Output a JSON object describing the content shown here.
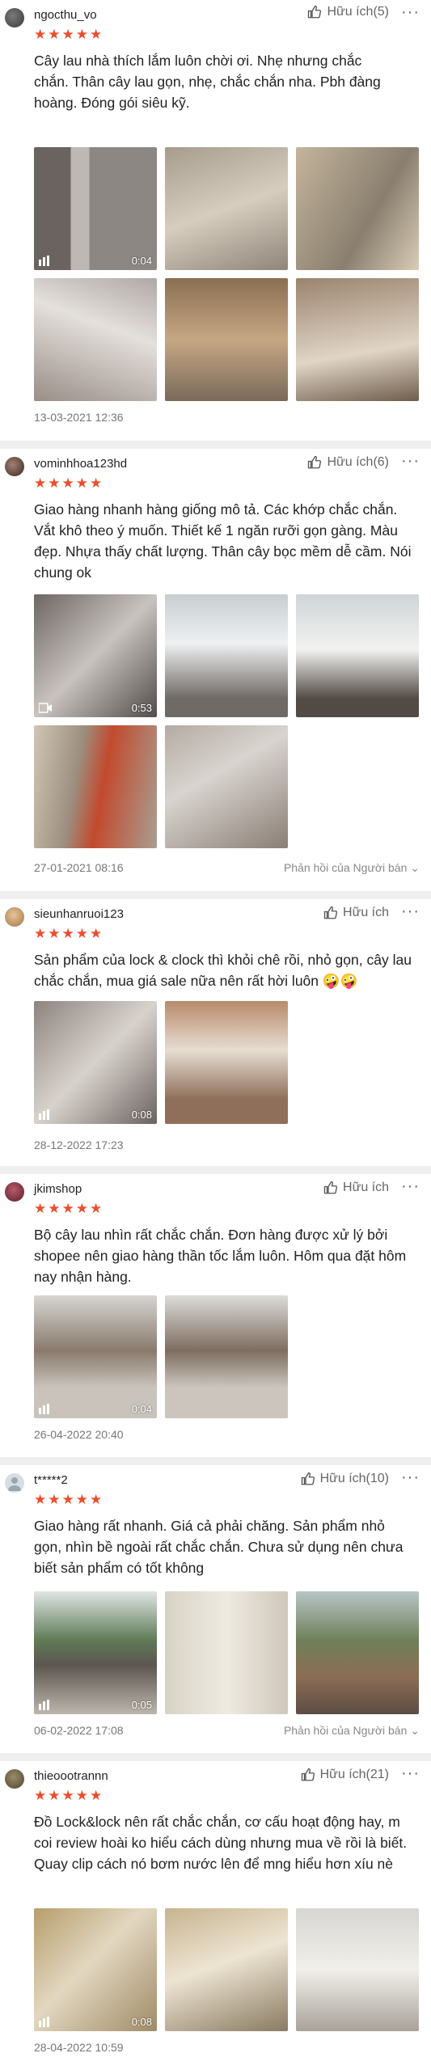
{
  "reviews": [
    {
      "username": "ngocthu_vo",
      "helpful": "Hữu ích(5)",
      "text": "Cây lau nhà thích lắm luôn chời ơi. Nhẹ nhưng chắc chắn. Thân cây lau gọn, nhẹ, chắc chắn nha. Pbh đàng hoàng. Đóng gói siêu kỹ.",
      "media_durations": [
        "0:04"
      ],
      "date": "13-03-2021 12:36",
      "reply": ""
    },
    {
      "username": "vominhhoa123hd",
      "helpful": "Hữu ích(6)",
      "text": "Giao hàng nhanh hàng giống mô tả. Các khớp chắc chắn. Vắt khô theo ý muốn. Thiết kế 1 ngăn rưỡi gọn gàng. Màu đẹp. Nhựa thấy chất lượng. Thân cây bọc mềm dễ cầm. Nói chung ok",
      "media_durations": [
        "0:53"
      ],
      "date": "27-01-2021 08:16",
      "reply": "Phản hồi của Người bán"
    },
    {
      "username": "sieunhanruoi123",
      "helpful": "Hữu ích",
      "text": "Sản phẩm của lock & clock thì khỏi chê rồi, nhỏ gọn, cây lau chắc chắn, mua giá sale nữa nên rất hời luôn 🤪🤪",
      "media_durations": [
        "0:08"
      ],
      "date": "28-12-2022 17:23",
      "reply": ""
    },
    {
      "username": "jkimshop",
      "helpful": "Hữu ích",
      "text": "Bộ cây lau nhìn rất chắc chắn. Đơn hàng được xử lý bởi shopee nên giao hàng thần tốc lắm luôn. Hôm qua đặt hôm nay nhận hàng.",
      "media_durations": [
        "0:04"
      ],
      "date": "26-04-2022 20:40",
      "reply": ""
    },
    {
      "username": "t*****2",
      "helpful": "Hữu ích(10)",
      "text": "Giao hàng rất nhanh. Giá cả phải chăng. Sản phẩm nhỏ gọn, nhìn bề ngoài rất chắc chắn. Chưa sử dụng nên chưa biết sản phẩm có tốt không",
      "media_durations": [
        "0:05"
      ],
      "date": "06-02-2022 17:08",
      "reply": "Phản hồi của Người bán"
    },
    {
      "username": "thieoootrannn",
      "helpful": "Hữu ích(21)",
      "text": "Đồ Lock&lock nên rất chắc chắn, cơ cấu hoạt động hay, m coi review hoài ko hiểu cách dùng nhưng mua về rồi là biết. Quay clip cách nó bơm nước lên để mng hiểu hơn xíu nè",
      "media_durations": [
        "0:08"
      ],
      "date": "28-04-2022 10:59",
      "reply": ""
    }
  ],
  "icons": {
    "thumb": "thumbs-up-icon",
    "more": "more-icon",
    "star": "star-icon",
    "video": "video-camera-icon"
  },
  "colors": {
    "star": "#ee4d2d",
    "muted": "#777777"
  }
}
